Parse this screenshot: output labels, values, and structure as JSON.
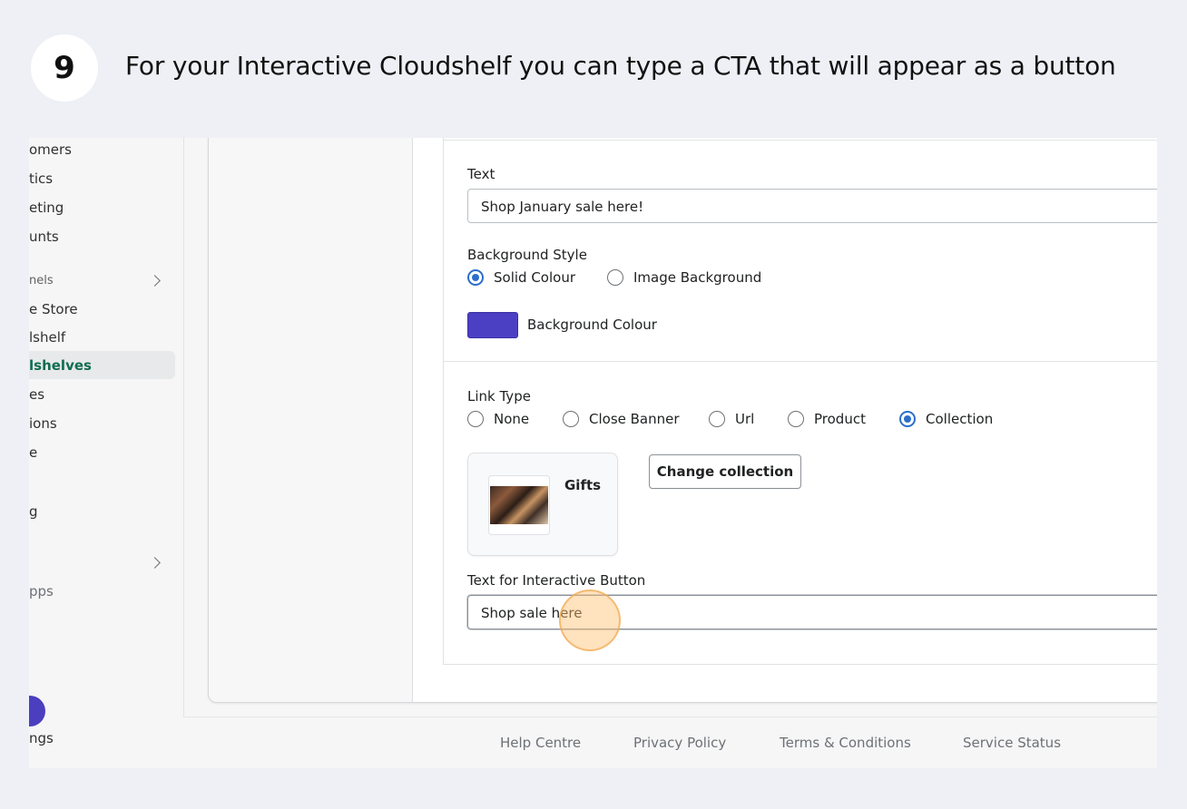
{
  "step": {
    "number": "9",
    "text": "For your Interactive Cloudshelf you can type a CTA that will appear as a button"
  },
  "sidebar": {
    "items": [
      {
        "label": "omers"
      },
      {
        "label": "tics"
      },
      {
        "label": "eting"
      },
      {
        "label": "unts"
      },
      {
        "label": "nels"
      },
      {
        "label": "e Store"
      },
      {
        "label": "lshelf"
      },
      {
        "label": "lshelves"
      },
      {
        "label": "es"
      },
      {
        "label": "ions"
      },
      {
        "label": "e"
      },
      {
        "label": "g"
      },
      {
        "label": "pps"
      },
      {
        "label": "ngs"
      }
    ]
  },
  "form": {
    "text_label": "Text",
    "text_value": "Shop January sale here!",
    "background_style_label": "Background Style",
    "background_options": [
      {
        "label": "Solid Colour",
        "checked": true
      },
      {
        "label": "Image Background",
        "checked": false
      }
    ],
    "background_colour_label": "Background Colour",
    "background_colour": "#4b3fc4",
    "link_type_label": "Link Type",
    "link_options": [
      {
        "label": "None",
        "checked": false
      },
      {
        "label": "Close Banner",
        "checked": false
      },
      {
        "label": "Url",
        "checked": false
      },
      {
        "label": "Product",
        "checked": false
      },
      {
        "label": "Collection",
        "checked": true
      }
    ],
    "collection_title": "Gifts",
    "change_collection_label": "Change collection",
    "button_text_label": "Text for Interactive Button",
    "button_text_value": "Shop sale here"
  },
  "footer": {
    "links": [
      "Help Centre",
      "Privacy Policy",
      "Terms & Conditions",
      "Service Status"
    ]
  },
  "colors": {
    "accent_radio": "#2c6ecb",
    "active_nav": "#0f6d4f"
  }
}
